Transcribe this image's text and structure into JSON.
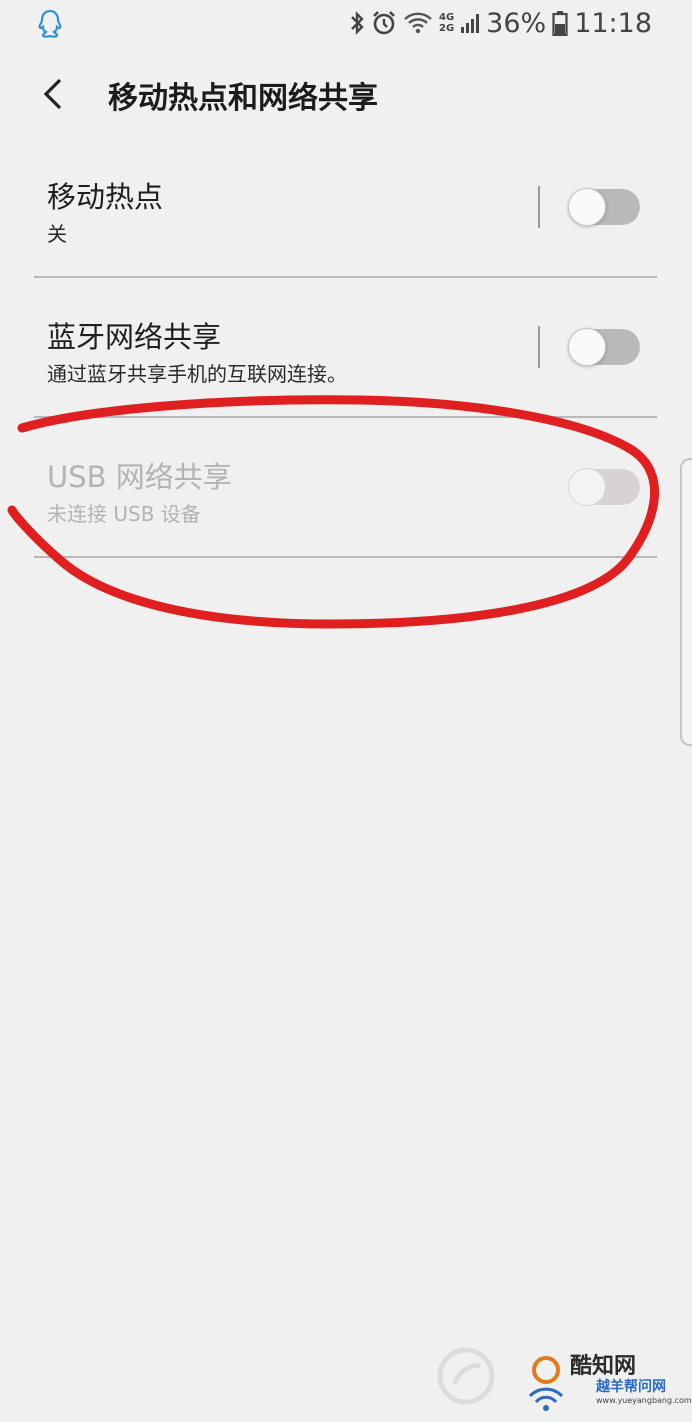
{
  "status_bar": {
    "time": "11:18",
    "battery": "36%",
    "net_top": "4G",
    "net_bottom": "2G",
    "icons": [
      "qq-icon",
      "bluetooth-icon",
      "alarm-icon",
      "wifi-icon",
      "signal-icon",
      "battery-icon"
    ]
  },
  "header": {
    "title": "移动热点和网络共享",
    "back_icon": "chevron-left-icon"
  },
  "settings": [
    {
      "title": "移动热点",
      "subtitle": "关",
      "enabled": true,
      "on": false
    },
    {
      "title": "蓝牙网络共享",
      "subtitle": "通过蓝牙共享手机的互联网连接。",
      "enabled": true,
      "on": false
    },
    {
      "title": "USB 网络共享",
      "subtitle": "未连接 USB 设备",
      "enabled": false,
      "on": false
    }
  ],
  "annotation": {
    "color": "#e02020",
    "shape": "hand-drawn-circle"
  },
  "watermark": {
    "name": "酷知网",
    "sub": "越羊帮问网",
    "url": "www.yueyangbang.com"
  },
  "colors": {
    "background": "#f0f0f0",
    "toggle_off_track": "#b9b9b9",
    "disabled_text": "#b3b3b3",
    "divider": "#b8b8b8"
  }
}
